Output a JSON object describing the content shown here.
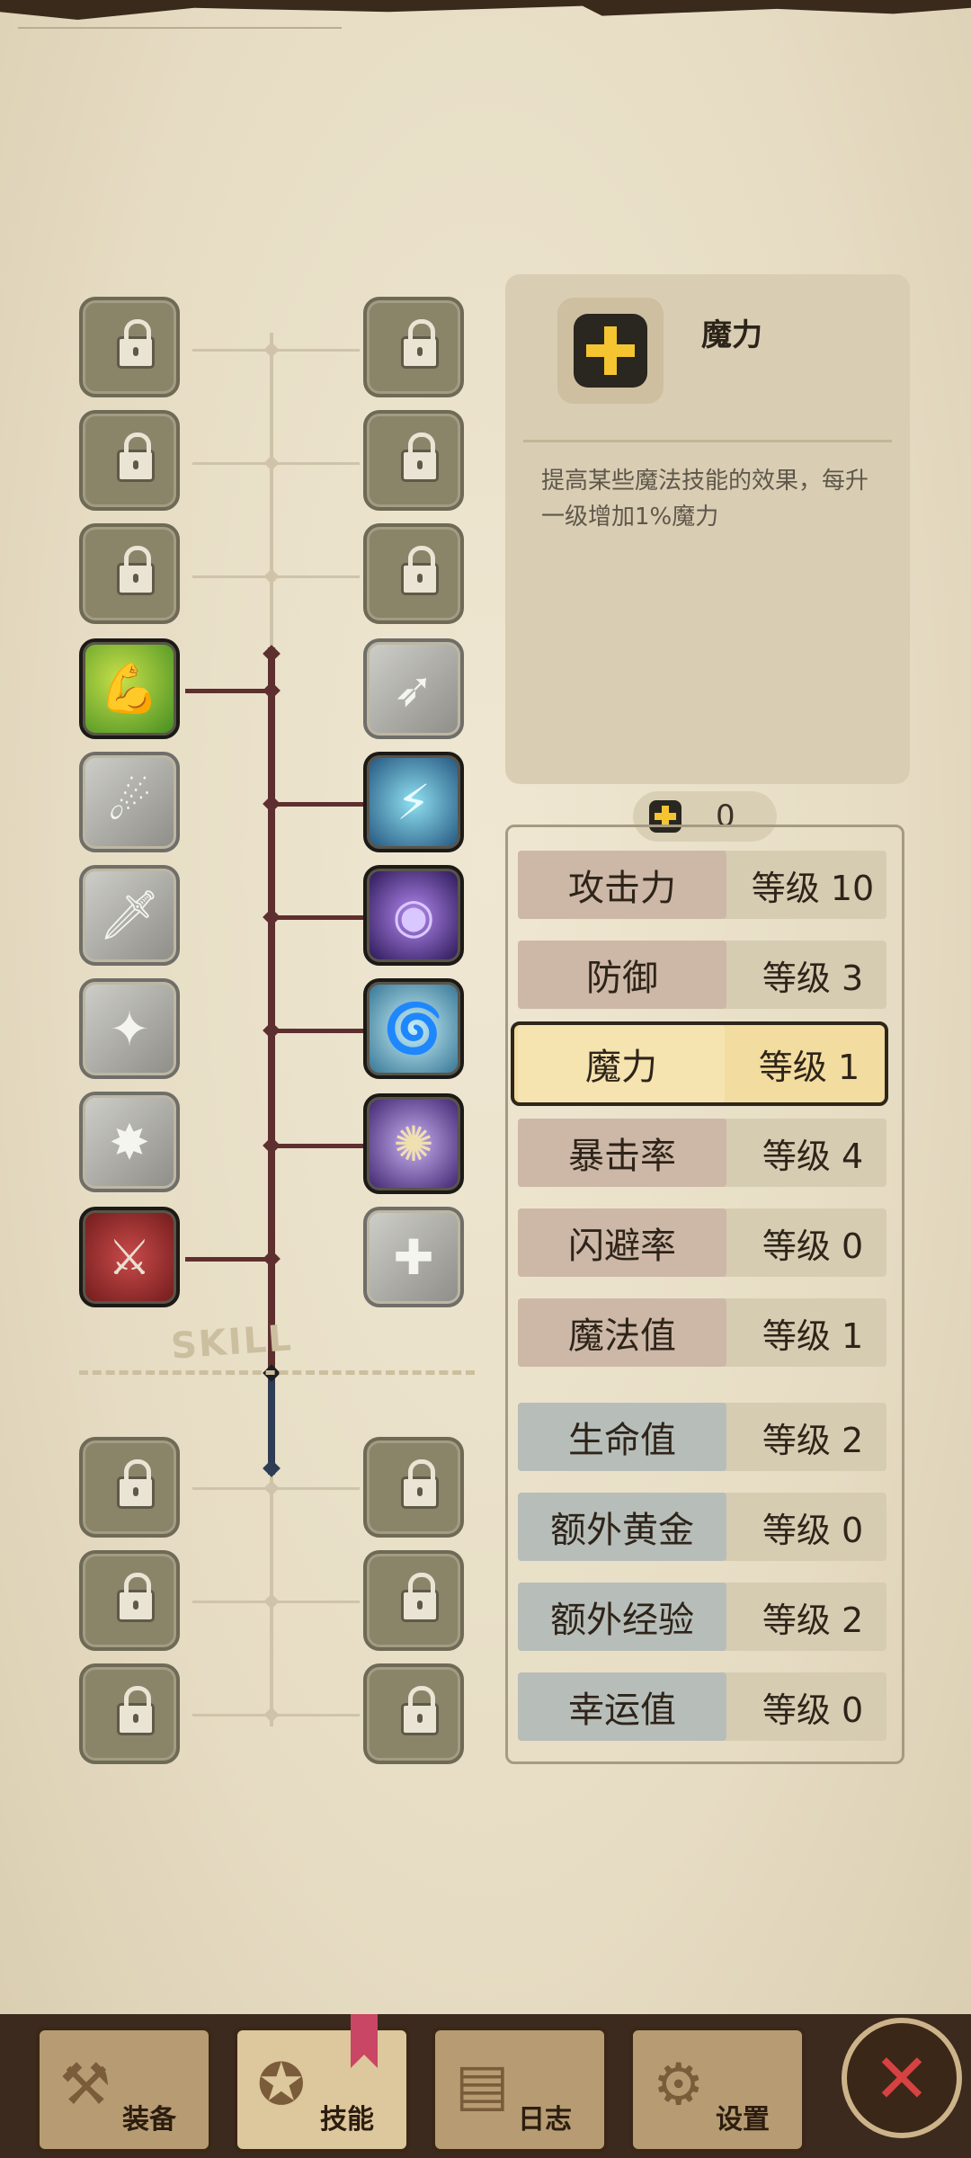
{
  "skill_panel": {
    "title": "魔力",
    "description": "提高某些魔法技能的效果，每升一级增加1%魔力",
    "icon": "plus-icon"
  },
  "points": {
    "value": "0",
    "icon": "plus-icon"
  },
  "stats": [
    {
      "name": "攻击力",
      "level": "等级 10",
      "group": "warm"
    },
    {
      "name": "防御",
      "level": "等级 3",
      "group": "warm"
    },
    {
      "name": "魔力",
      "level": "等级 1",
      "group": "warm",
      "selected": true
    },
    {
      "name": "暴击率",
      "level": "等级 4",
      "group": "warm"
    },
    {
      "name": "闪避率",
      "level": "等级 0",
      "group": "warm"
    },
    {
      "name": "魔法值",
      "level": "等级 1",
      "group": "warm"
    },
    {
      "name": "生命值",
      "level": "等级 2",
      "group": "cool"
    },
    {
      "name": "额外黄金",
      "level": "等级 0",
      "group": "cool"
    },
    {
      "name": "额外经验",
      "level": "等级 2",
      "group": "cool"
    },
    {
      "name": "幸运值",
      "level": "等级 0",
      "group": "cool"
    }
  ],
  "watermark": "SKILL",
  "nav": {
    "tabs": [
      {
        "label": "装备",
        "icon": "axe-icon"
      },
      {
        "label": "技能",
        "icon": "skill-icon",
        "active": true
      },
      {
        "label": "日志",
        "icon": "scroll-icon"
      },
      {
        "label": "设置",
        "icon": "gear-icon"
      }
    ],
    "close_icon": "close-icon"
  },
  "colors": {
    "accent": "#f4c531",
    "tree_line": "#5e2f2f",
    "selected_row": "#f2dc9f"
  }
}
